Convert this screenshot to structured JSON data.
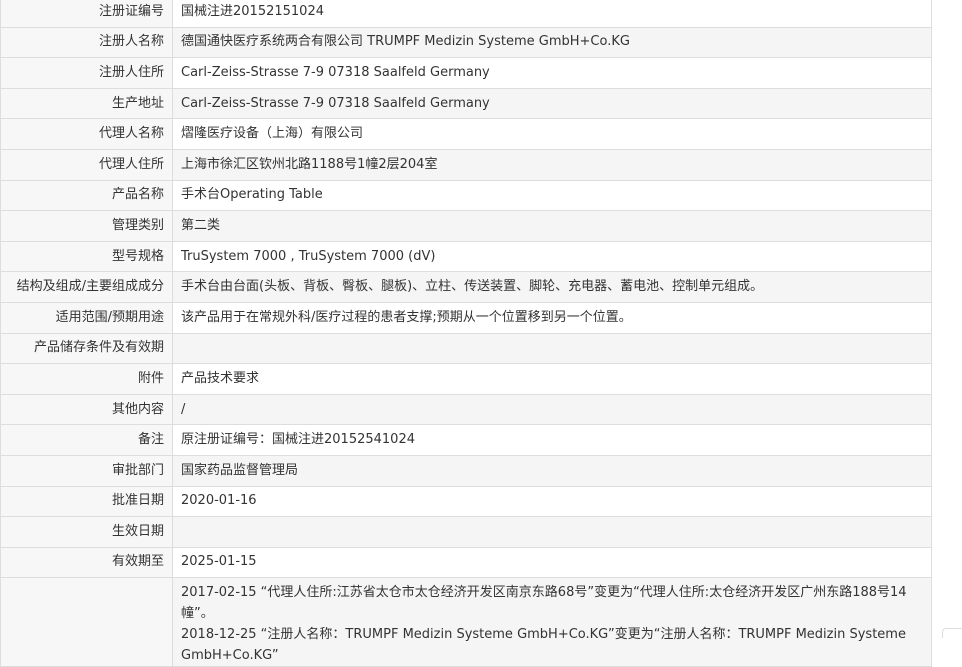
{
  "rows": [
    {
      "label": "注册证编号",
      "value": "国械注进20152151024"
    },
    {
      "label": "注册人名称",
      "value": "德国通快医疗系统两合有限公司 TRUMPF Medizin Systeme GmbH+Co.KG"
    },
    {
      "label": "注册人住所",
      "value": "Carl-Zeiss-Strasse 7-9 07318 Saalfeld Germany"
    },
    {
      "label": "生产地址",
      "value": "Carl-Zeiss-Strasse 7-9 07318 Saalfeld Germany"
    },
    {
      "label": "代理人名称",
      "value": "熠隆医疗设备（上海）有限公司"
    },
    {
      "label": "代理人住所",
      "value": "上海市徐汇区钦州北路1188号1幢2层204室"
    },
    {
      "label": "产品名称",
      "value": "手术台Operating Table"
    },
    {
      "label": "管理类别",
      "value": "第二类"
    },
    {
      "label": "型号规格",
      "value": "TruSystem 7000 , TruSystem 7000 (dV)"
    },
    {
      "label": "结构及组成/主要组成成分",
      "value": "手术台由台面(头板、背板、臀板、腿板)、立柱、传送装置、脚轮、充电器、蓄电池、控制单元组成。"
    },
    {
      "label": "适用范围/预期用途",
      "value": "该产品用于在常规外科/医疗过程的患者支撑;预期从一个位置移到另一个位置。"
    },
    {
      "label": "产品储存条件及有效期",
      "value": ""
    },
    {
      "label": "附件",
      "value": "产品技术要求"
    },
    {
      "label": "其他内容",
      "value": "/"
    },
    {
      "label": "备注",
      "value": "原注册证编号：国械注进20152541024"
    },
    {
      "label": "审批部门",
      "value": "国家药品监督管理局"
    },
    {
      "label": "批准日期",
      "value": "2020-01-16"
    },
    {
      "label": "生效日期",
      "value": ""
    },
    {
      "label": "有效期至",
      "value": "2025-01-15"
    }
  ],
  "change_history": [
    "2017-02-15 “代理人住所:江苏省太仓市太仓经济开发区南京东路68号”变更为“代理人住所:太仓经济开发区广州东路188号14幢”。",
    "2018-12-25 “注册人名称：TRUMPF Medizin Systeme GmbH+Co.KG”变更为“注册人名称：TRUMPF Medizin Systeme GmbH+Co.KG”"
  ]
}
